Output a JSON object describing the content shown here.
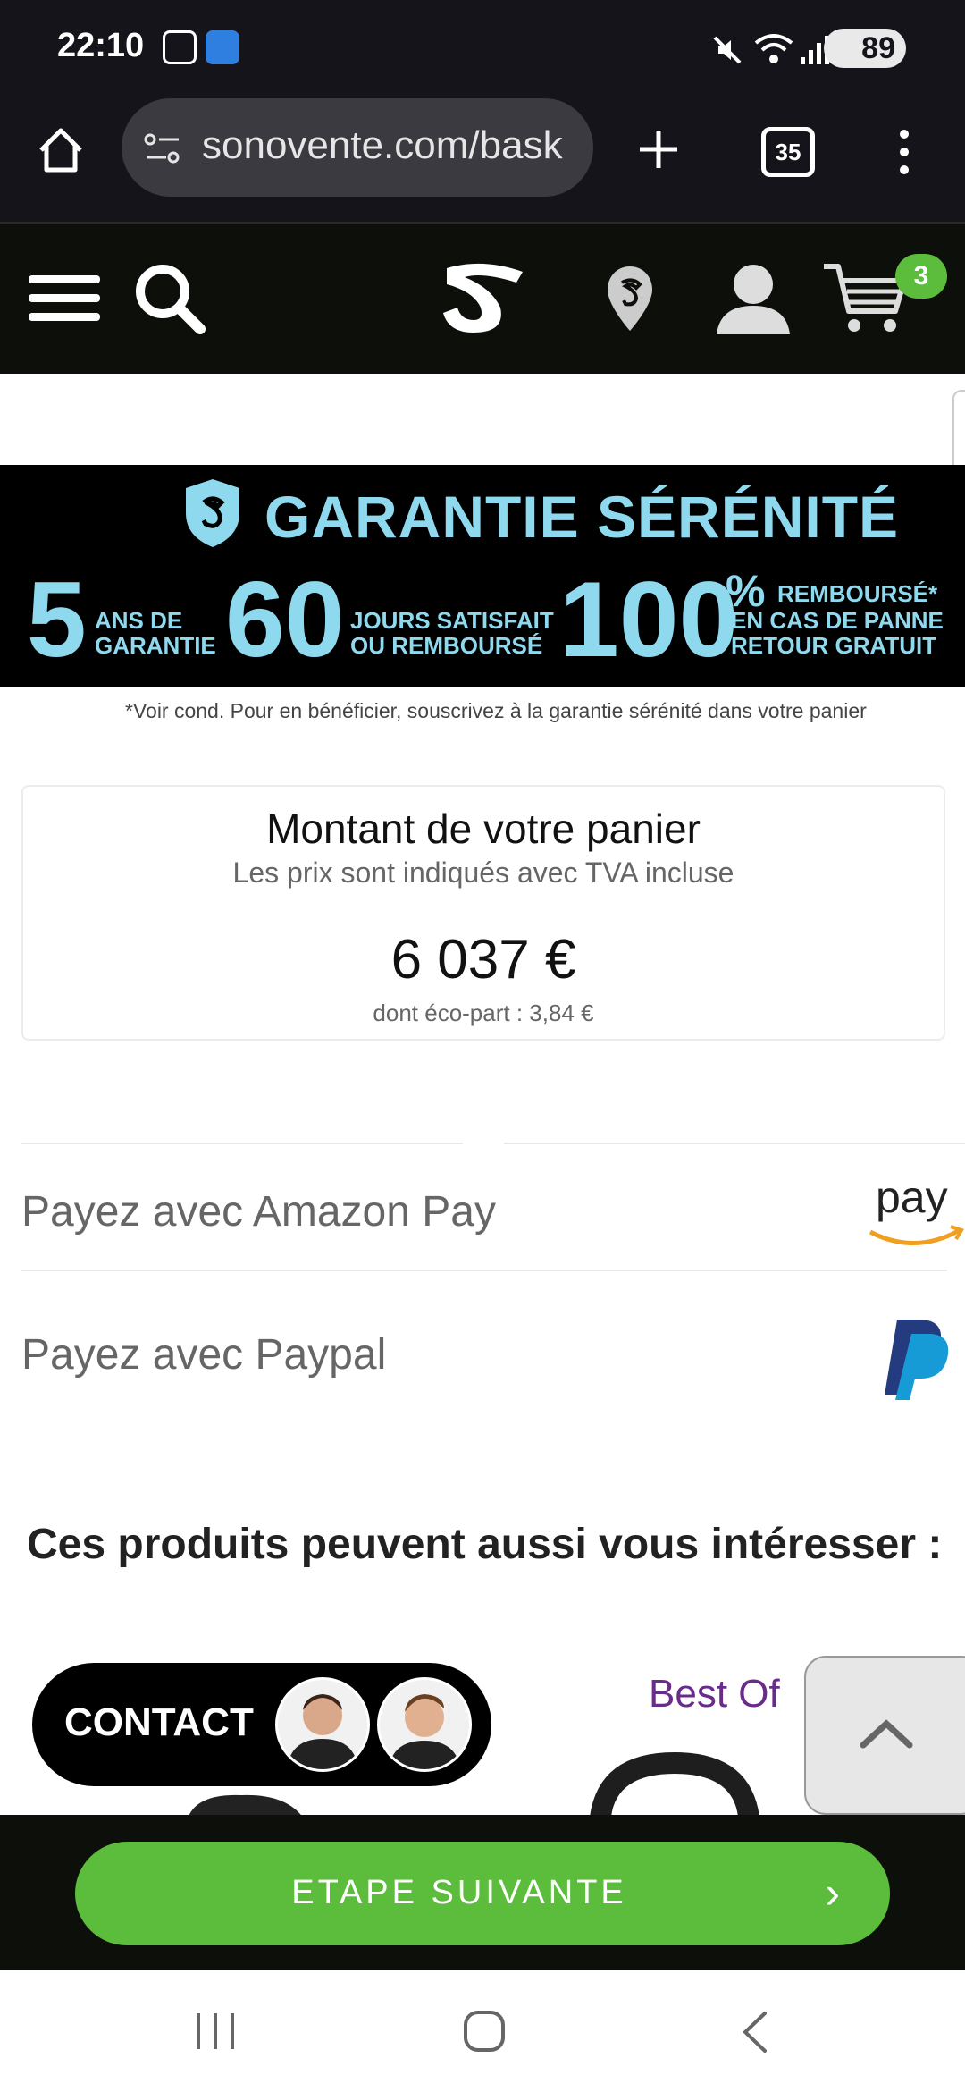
{
  "status_bar": {
    "time": "22:10",
    "battery": "89"
  },
  "browser": {
    "url": "sonovente.com/bask",
    "tab_count": "35"
  },
  "site_header": {
    "cart_count": "3"
  },
  "banner": {
    "title": "GARANTIE SÉRÉNITÉ",
    "item1_number": "5",
    "item1_text_line1": "ANS DE",
    "item1_text_line2": "GARANTIE",
    "item2_number": "60",
    "item2_text_line1": "JOURS SATISFAIT",
    "item2_text_line2": "OU REMBOURSÉ",
    "item3_number": "100",
    "item3_percent": "%",
    "item3_text_line1": "REMBOURSÉ*",
    "item3_text_line2": "EN CAS DE PANNE",
    "item3_text_line3": "RETOUR GRATUIT",
    "note": "*Voir cond. Pour en bénéficier, souscrivez à la garantie sérénité dans votre panier"
  },
  "basket": {
    "title": "Montant de votre panier",
    "subtitle": "Les prix sont indiqués avec TVA incluse",
    "amount": "6 037 €",
    "eco_part": "dont éco-part : 3,84 €"
  },
  "payments": [
    {
      "label": "Payez avec Amazon Pay",
      "logo_text": "pay"
    },
    {
      "label": "Payez avec Paypal"
    }
  ],
  "recommendations": {
    "title": "Ces produits peuvent aussi vous intéresser :",
    "contact_label": "CONTACT",
    "badge": "Best Of"
  },
  "bottom_bar": {
    "next_label": "ETAPE SUIVANTE",
    "next_chevron": "›"
  },
  "colors": {
    "accent_green": "#5bbd3b",
    "banner_blue": "#8fd9ee",
    "best_of_purple": "#6a2c8a"
  }
}
